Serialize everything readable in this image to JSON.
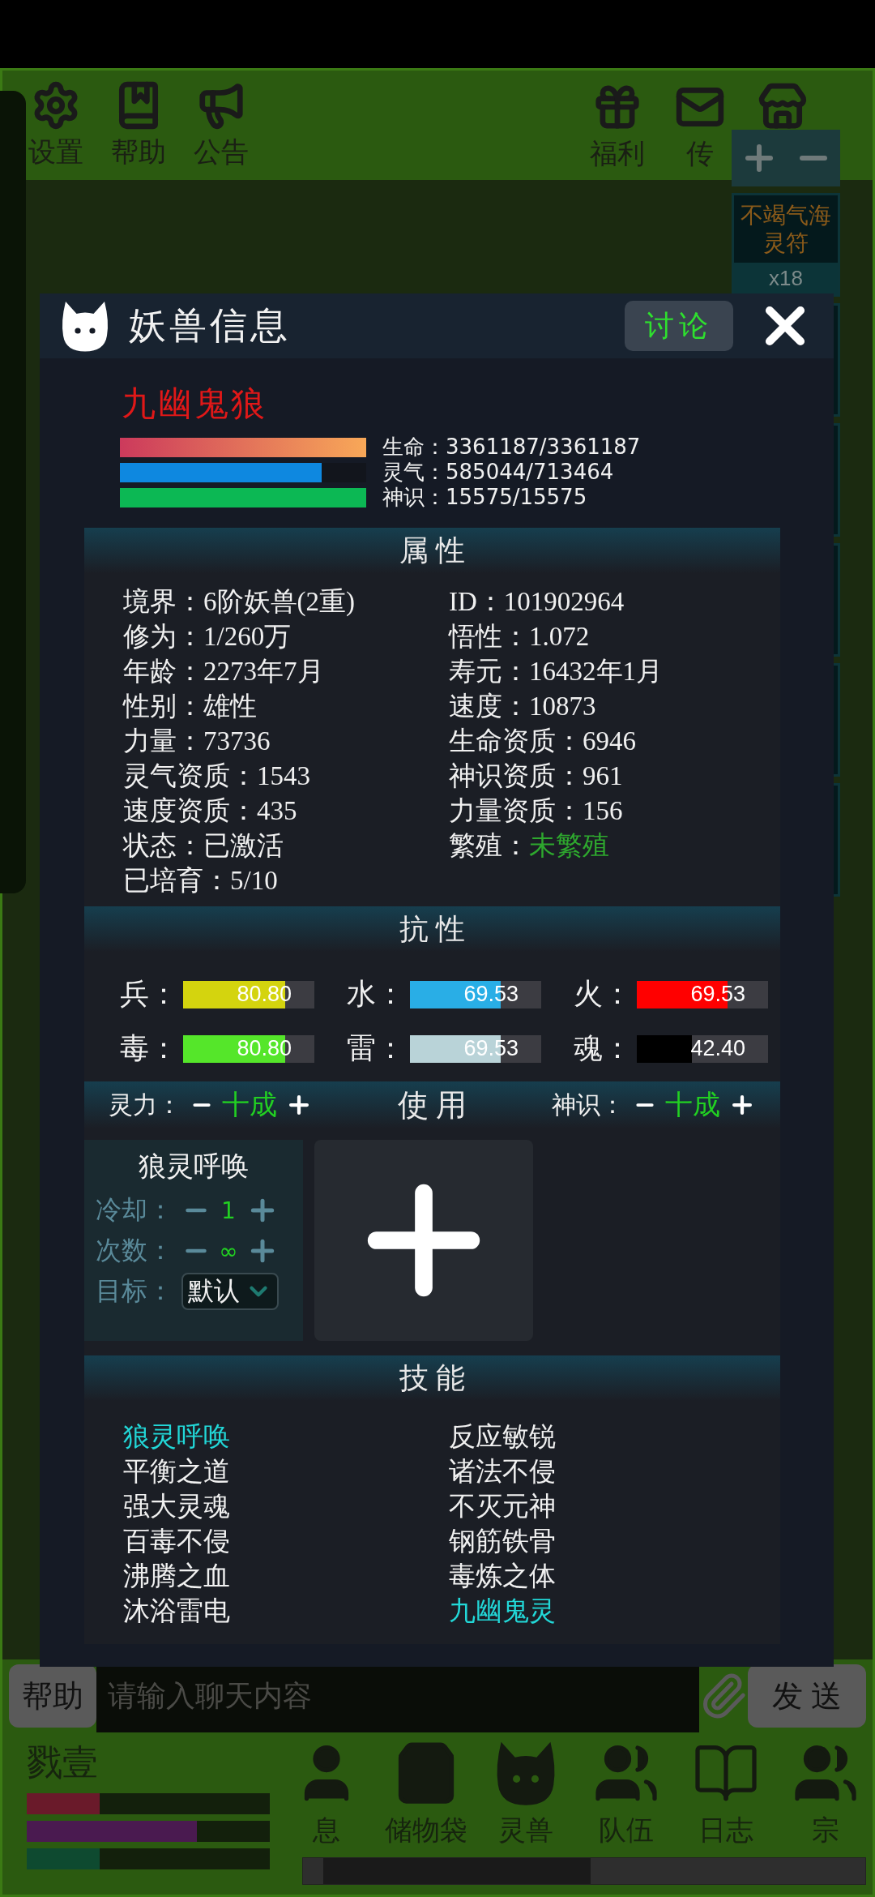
{
  "top_bar": {
    "items": [
      {
        "label": "设置"
      },
      {
        "label": "帮助"
      },
      {
        "label": "公告"
      }
    ],
    "right_items": [
      {
        "label": "福利"
      },
      {
        "label": "传"
      }
    ]
  },
  "side_panel": {
    "item": {
      "name": "不竭气海灵符",
      "count": "x18"
    }
  },
  "dialog": {
    "title": "妖兽信息",
    "discuss_button": "讨论",
    "name": "九幽鬼狼",
    "stats": [
      {
        "kind": "hp",
        "label": "生命：3361187/3361187"
      },
      {
        "kind": "mp",
        "label": "灵气：585044/713464",
        "level": 0.82
      },
      {
        "kind": "sense",
        "label": "神识：15575/15575"
      }
    ],
    "attributes_title": "属 性",
    "attributes": [
      {
        "label": "境界：",
        "value": "6阶妖兽(2重)"
      },
      {
        "label": "ID：",
        "value": "101902964"
      },
      {
        "label": "修为：",
        "value": "1/260万"
      },
      {
        "label": "悟性：",
        "value": "1.072"
      },
      {
        "label": "年龄：",
        "value": "2273年7月"
      },
      {
        "label": "寿元：",
        "value": "16432年1月"
      },
      {
        "label": "性别：",
        "value": "雄性"
      },
      {
        "label": "速度：",
        "value": "10873"
      },
      {
        "label": "力量：",
        "value": "73736"
      },
      {
        "label": "生命资质：",
        "value": "6946"
      },
      {
        "label": "灵气资质：",
        "value": "1543"
      },
      {
        "label": "神识资质：",
        "value": "961"
      },
      {
        "label": "速度资质：",
        "value": "435"
      },
      {
        "label": "力量资质：",
        "value": "156"
      },
      {
        "label": "状态：",
        "value": "已激活"
      },
      {
        "label": "繁殖：",
        "value": "未繁殖",
        "color": "#2ea82e"
      },
      {
        "label": "已培育：",
        "value": "5/10"
      }
    ],
    "resistance_title": "抗 性",
    "resistances": [
      {
        "label": "兵：",
        "value": "80.80",
        "level": 0.78,
        "color": "#d4d40e"
      },
      {
        "label": "水：",
        "value": "69.53",
        "level": 0.69,
        "color": "#29aee6"
      },
      {
        "label": "火：",
        "value": "69.53",
        "level": 0.69,
        "color": "#ff0000"
      },
      {
        "label": "毒：",
        "value": "80.80",
        "level": 0.78,
        "color": "#55e62a"
      },
      {
        "label": "雷：",
        "value": "69.53",
        "level": 0.69,
        "color": "#b9d3d8"
      },
      {
        "label": "魂：",
        "value": "42.40",
        "level": 0.42,
        "color": "#000000"
      }
    ],
    "use_bar": {
      "left_label": "灵力：",
      "left_value": "十成",
      "title": "使 用",
      "right_label": "神识：",
      "right_value": "十成"
    },
    "skill_slot": {
      "title": "狼灵呼唤",
      "cooldown_label": "冷却：",
      "cooldown": "1",
      "times_label": "次数：",
      "times": "∞",
      "target_label": "目标：",
      "target": "默认"
    },
    "skills_title": "技 能",
    "skills": [
      {
        "name": "狼灵呼唤",
        "highlighted": true
      },
      {
        "name": "反应敏锐",
        "highlighted": false
      },
      {
        "name": "平衡之道",
        "highlighted": false
      },
      {
        "name": "诸法不侵",
        "highlighted": false
      },
      {
        "name": "强大灵魂",
        "highlighted": false
      },
      {
        "name": "不灭元神",
        "highlighted": false
      },
      {
        "name": "百毒不侵",
        "highlighted": false
      },
      {
        "name": "钢筋铁骨",
        "highlighted": false
      },
      {
        "name": "沸腾之血",
        "highlighted": false
      },
      {
        "name": "毒炼之体",
        "highlighted": false
      },
      {
        "name": "沐浴雷电",
        "highlighted": false
      },
      {
        "name": "九幽鬼灵",
        "highlighted": true
      }
    ]
  },
  "chat": {
    "help_button": "帮助",
    "placeholder": "请输入聊天内容",
    "send_button": "发 送"
  },
  "player": {
    "name": "戮壹",
    "bars": [
      {
        "level": 0.3,
        "color": "#6a1a2a"
      },
      {
        "level": 0.7,
        "color": "#4a1a50"
      },
      {
        "level": 0.3,
        "color": "#0e4a30"
      }
    ]
  },
  "nav": [
    {
      "label": "息"
    },
    {
      "label": "储物袋"
    },
    {
      "label": "灵兽"
    },
    {
      "label": "队伍"
    },
    {
      "label": "日志"
    },
    {
      "label": "宗"
    }
  ]
}
